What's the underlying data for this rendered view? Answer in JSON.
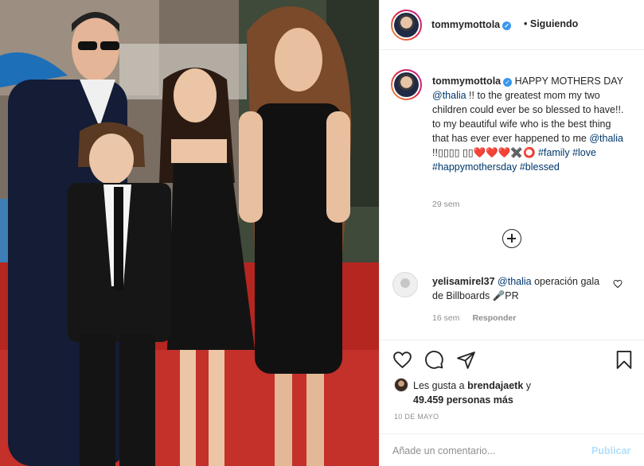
{
  "header": {
    "username": "tommymottola",
    "separator": "•",
    "follow_label": "Siguiendo"
  },
  "caption": {
    "username": "tommymottola",
    "part1": " HAPPY MOTHERS DAY ",
    "mention1": "@thalia",
    "part2": " !! to the greatest mom my two children could ever be so blessed to have!!. to my beautiful wife who is the best thing that has ever ever happened to me ",
    "mention2": "@thalia",
    "part3": " !!▯▯▯▯ ▯▯❤️❤️❤️✖️⭕ ",
    "tag1": "#family",
    "tag2": "#love",
    "tag3": "#happymothersday",
    "tag4": "#blessed",
    "time": "29 sem"
  },
  "comment": {
    "username": "yelisamirel37",
    "mention": "@thalia",
    "text": " operación gala de Billboards 🎤PR",
    "time": "16 sem",
    "reply_label": "Responder"
  },
  "likes": {
    "prefix": "Les gusta a ",
    "user": "brendajaetk",
    "conj": " y",
    "count": "49.459 personas más"
  },
  "date": "10 DE MAYO",
  "add_comment": {
    "placeholder": "Añade un comentario...",
    "publish_label": "Publicar"
  },
  "icons": {
    "verified": "verified-badge-icon",
    "heart": "heart-icon",
    "comment": "comment-icon",
    "share": "share-icon",
    "save": "bookmark-icon",
    "more": "plus-circle-icon"
  },
  "colors": {
    "link": "#00376b",
    "verified": "#3897f0",
    "publish_disabled": "#b2dffc",
    "muted": "#8e8e8e"
  }
}
